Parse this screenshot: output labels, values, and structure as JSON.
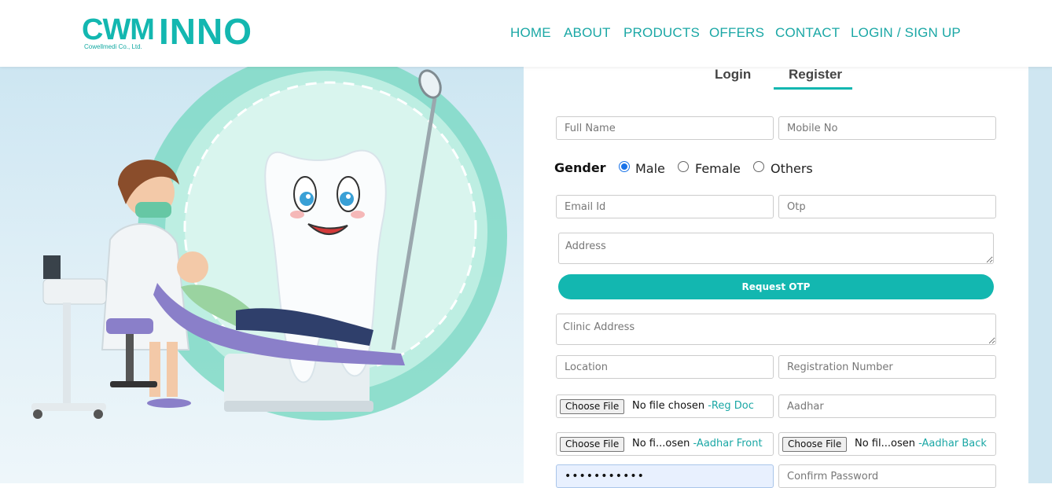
{
  "brand": {
    "logo_main": "CWM",
    "logo_sub": "Cowellmedi Co., Ltd.",
    "logo_product": "INNO"
  },
  "nav": {
    "items": [
      {
        "label": "HOME"
      },
      {
        "label": "ABOUT"
      },
      {
        "label": "PRODUCTS"
      },
      {
        "label": "OFFERS"
      },
      {
        "label": "CONTACT"
      },
      {
        "label": "LOGIN / SIGN UP"
      }
    ]
  },
  "tabs": {
    "login": "Login",
    "register": "Register",
    "active": "Register"
  },
  "form": {
    "full_name_placeholder": "Full Name",
    "mobile_placeholder": "Mobile No",
    "gender_label": "Gender",
    "gender_options": [
      {
        "label": "Male",
        "checked": true
      },
      {
        "label": "Female",
        "checked": false
      },
      {
        "label": "Others",
        "checked": false
      }
    ],
    "email_placeholder": "Email Id",
    "otp_placeholder": "Otp",
    "address_placeholder": "Address",
    "request_otp_label": "Request OTP",
    "clinic_address_placeholder": "Clinic Address",
    "location_placeholder": "Location",
    "registration_number_placeholder": "Registration Number",
    "reg_doc": {
      "button": "Choose File",
      "status": "No file chosen",
      "hint": "-Reg Doc"
    },
    "aadhar_placeholder": "Aadhar",
    "aadhar_front": {
      "button": "Choose File",
      "status": "No fi...osen",
      "hint": "-Aadhar Front"
    },
    "aadhar_back": {
      "button": "Choose File",
      "status": "No fil...osen",
      "hint": "-Aadhar Back"
    },
    "password_value": "•••••••••••",
    "confirm_password_placeholder": "Confirm Password"
  },
  "colors": {
    "accent": "#13b7b0",
    "nav_text": "#1aa7a5",
    "hero_bg": "#d6ebf4"
  },
  "illustration": {
    "icon": "dentist-illustration-icon"
  }
}
